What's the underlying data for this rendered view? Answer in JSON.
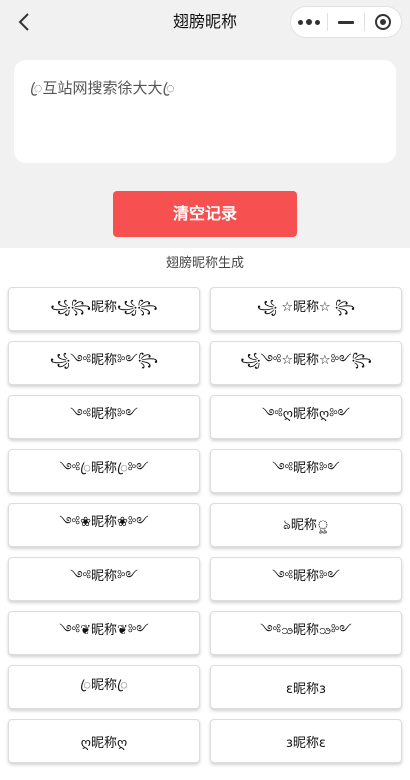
{
  "header": {
    "title": "翅膀昵称"
  },
  "input": {
    "value": "ꦿ互站网搜索徐大大ꦿ"
  },
  "clear_button": {
    "label": "清空记录"
  },
  "section_title": "翅膀昵称生成",
  "results": [
    "꧁꧂昵称꧁꧂",
    "꧁ ☆昵称☆ ꧂",
    "꧁༺昵称༻꧂",
    "꧁༺☆昵称☆༻꧂",
    "༺昵称༻",
    "༺ღ昵称ღ༻",
    "༺ꦿ昵称ꦿ༻",
    "༺昵称༻",
    "༺❀昵称❀༻",
    "ঌ昵称ৣ",
    "༺昵称༻",
    "༺昵称༻",
    "༺❦昵称❦༻",
    "༺ꧢ昵称ꧢ༻",
    "ꦿ昵称ꦿ",
    "ε昵称з",
    "ღ昵称ღ",
    "з昵称ε"
  ]
}
